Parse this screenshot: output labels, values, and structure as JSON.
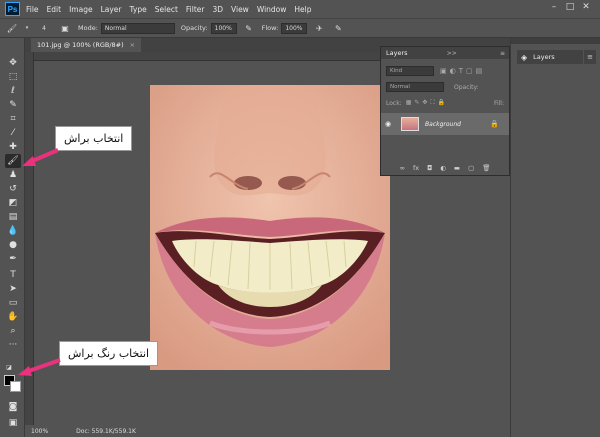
{
  "app": {
    "logo": "Ps",
    "menus": [
      "File",
      "Edit",
      "Image",
      "Layer",
      "Type",
      "Select",
      "Filter",
      "3D",
      "View",
      "Window",
      "Help"
    ],
    "window_controls": [
      "–",
      "□",
      "✕"
    ]
  },
  "options_bar": {
    "mode_label": "Mode:",
    "mode_value": "Normal",
    "opacity_label": "Opacity:",
    "opacity_value": "100%",
    "flow_label": "Flow:",
    "flow_value": "100%",
    "brush_size": "4"
  },
  "document": {
    "tab_title": "101.jpg @ 100% (RGB/8#)",
    "close": "×"
  },
  "status_bar": {
    "zoom": "100%",
    "doc_info": "Doc: 559.1K/559.1K"
  },
  "layers_panel": {
    "title": "Layers",
    "collapse": ">>",
    "filter_placeholder": "Kind",
    "blend_mode": "Normal",
    "opacity_label": "Opacity:",
    "lock_label": "Lock:",
    "fill_label": "Fill:",
    "layer_name": "Background"
  },
  "dock": {
    "layers_button": "Layers"
  },
  "callouts": {
    "brush_select": "انتخاب براش",
    "brush_color_select": "انتخاب رنگ براش"
  },
  "colors": {
    "ui_bg": "#535353",
    "accent_pink": "#e8327d",
    "ps_blue": "#31a8ff"
  }
}
